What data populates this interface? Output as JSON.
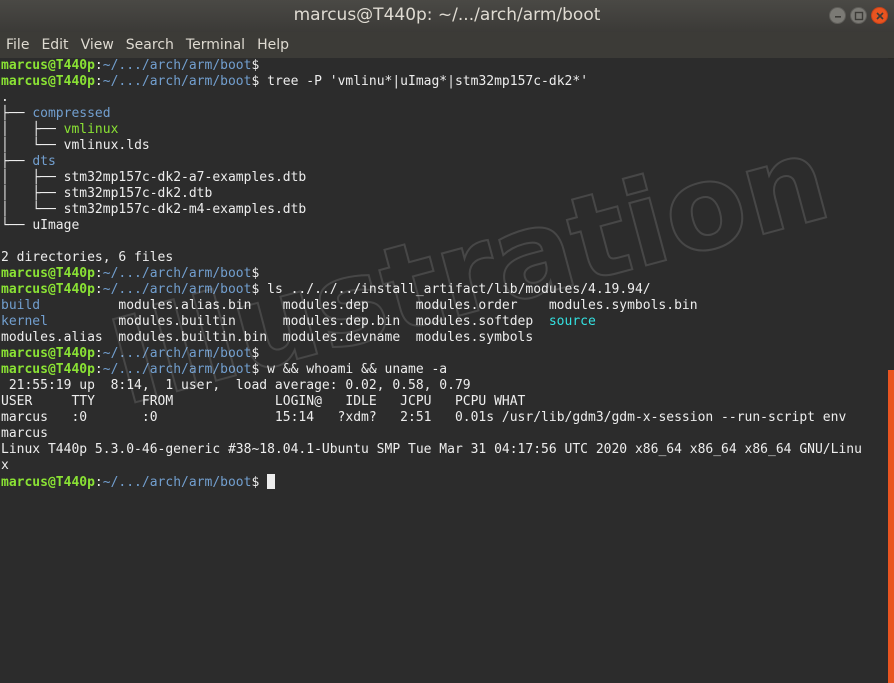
{
  "window": {
    "title": "marcus@T440p: ~/.../arch/arm/boot"
  },
  "menu": [
    "File",
    "Edit",
    "View",
    "Search",
    "Terminal",
    "Help"
  ],
  "prompt": {
    "user": "marcus@T440p",
    "sep": ":",
    "path": "~/.../arch/arm/boot",
    "sigil": "$"
  },
  "lines": [
    {
      "type": "prompt",
      "cmd": ""
    },
    {
      "type": "prompt",
      "cmd": " tree -P 'vmlinu*|uImag*|stm32mp157c-dk2*'"
    },
    {
      "type": "text",
      "text": "."
    },
    {
      "type": "tree",
      "prefix": "├── ",
      "name": "compressed",
      "color": "dir"
    },
    {
      "type": "tree",
      "prefix": "│   ├── ",
      "name": "vmlinux",
      "color": "exe"
    },
    {
      "type": "tree",
      "prefix": "│   └── ",
      "name": "vmlinux.lds",
      "color": ""
    },
    {
      "type": "tree",
      "prefix": "├── ",
      "name": "dts",
      "color": "dir"
    },
    {
      "type": "tree",
      "prefix": "│   ├── ",
      "name": "stm32mp157c-dk2-a7-examples.dtb",
      "color": ""
    },
    {
      "type": "tree",
      "prefix": "│   ├── ",
      "name": "stm32mp157c-dk2.dtb",
      "color": ""
    },
    {
      "type": "tree",
      "prefix": "│   └── ",
      "name": "stm32mp157c-dk2-m4-examples.dtb",
      "color": ""
    },
    {
      "type": "tree",
      "prefix": "└── ",
      "name": "uImage",
      "color": ""
    },
    {
      "type": "text",
      "text": ""
    },
    {
      "type": "text",
      "text": "2 directories, 6 files"
    },
    {
      "type": "prompt",
      "cmd": ""
    },
    {
      "type": "prompt",
      "cmd": " ls ../../../install_artifact/lib/modules/4.19.94/"
    },
    {
      "type": "ls",
      "cells": [
        {
          "text": "build",
          "color": "dir",
          "w": 15
        },
        {
          "text": "modules.alias.bin",
          "color": "",
          "w": 21
        },
        {
          "text": "modules.dep",
          "color": "",
          "w": 17
        },
        {
          "text": "modules.order",
          "color": "",
          "w": 17
        },
        {
          "text": "modules.symbols.bin",
          "color": "",
          "w": 0
        }
      ]
    },
    {
      "type": "ls",
      "cells": [
        {
          "text": "kernel",
          "color": "dir",
          "w": 15
        },
        {
          "text": "modules.builtin",
          "color": "",
          "w": 21
        },
        {
          "text": "modules.dep.bin",
          "color": "",
          "w": 17
        },
        {
          "text": "modules.softdep",
          "color": "",
          "w": 17
        },
        {
          "text": "source",
          "color": "lnk",
          "w": 0
        }
      ]
    },
    {
      "type": "ls",
      "cells": [
        {
          "text": "modules.alias",
          "color": "",
          "w": 15
        },
        {
          "text": "modules.builtin.bin",
          "color": "",
          "w": 21
        },
        {
          "text": "modules.devname",
          "color": "",
          "w": 17
        },
        {
          "text": "modules.symbols",
          "color": "",
          "w": 0
        }
      ]
    },
    {
      "type": "prompt",
      "cmd": ""
    },
    {
      "type": "prompt",
      "cmd": " w && whoami && uname -a"
    },
    {
      "type": "text",
      "text": " 21:55:19 up  8:14,  1 user,  load average: 0.02, 0.58, 0.79"
    },
    {
      "type": "text",
      "text": "USER     TTY      FROM             LOGIN@   IDLE   JCPU   PCPU WHAT"
    },
    {
      "type": "text",
      "text": "marcus   :0       :0               15:14   ?xdm?   2:51   0.01s /usr/lib/gdm3/gdm-x-session --run-script env"
    },
    {
      "type": "text",
      "text": "marcus"
    },
    {
      "type": "text",
      "text": "Linux T440p 5.3.0-46-generic #38~18.04.1-Ubuntu SMP Tue Mar 31 04:17:56 UTC 2020 x86_64 x86_64 x86_64 GNU/Linu"
    },
    {
      "type": "text",
      "text": "x"
    },
    {
      "type": "prompt",
      "cmd": " ",
      "cursor": true
    }
  ],
  "watermark": {
    "text": "Illustration"
  },
  "colors": {
    "accent": "#e95420",
    "user": "#8ae234",
    "path": "#729fcf",
    "link": "#34e2e2",
    "bg": "#2c2c2c"
  }
}
